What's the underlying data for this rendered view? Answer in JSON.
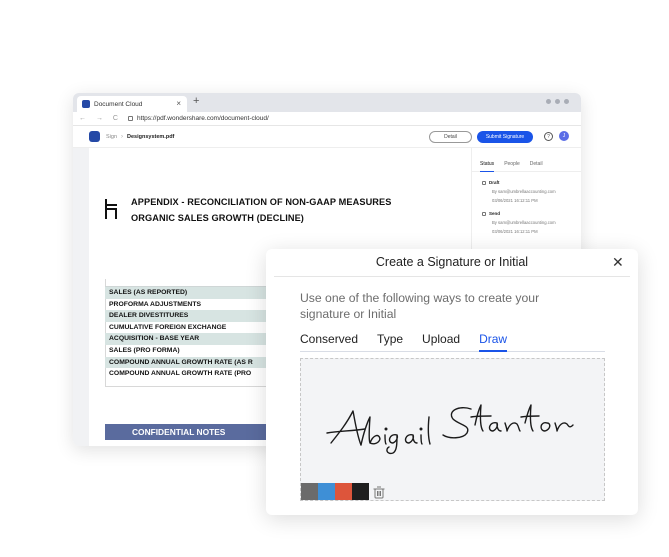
{
  "browser": {
    "tab_title": "Document Cloud",
    "tab_close": "×",
    "new_tab": "+",
    "url": "https://pdf.wondershare.com/document-cloud/",
    "nav": "← → C"
  },
  "app": {
    "breadcrumb_root": "Sign",
    "breadcrumb_sep": "›",
    "filename": "Designsystem.pdf",
    "detail_button": "Detail",
    "submit_button": "Submit Signature",
    "help_icon": "?",
    "avatar_initial": "J"
  },
  "document": {
    "title_line1": "APPENDIX - RECONCILIATION OF NON-GAAP MEASURES",
    "title_line2": "ORGANIC SALES GROWTH (DECLINE)",
    "rows": [
      "SALES (AS REPORTED)",
      "PROFORMA ADJUSTMENTS",
      "DEALER DIVESTITURES",
      "CUMULATIVE FOREIGN EXCHANGE",
      "ACQUISITION - BASE YEAR",
      "SALES (PRO FORMA)",
      "COMPOUND ANNUAL GROWTH RATE (AS R",
      "COMPOUND ANNUAL GROWTH RATE (PRO"
    ],
    "notes_heading": "CONFIDENTIAL NOTES"
  },
  "side_panel": {
    "tabs": [
      "Status",
      "People",
      "Detail"
    ],
    "events": [
      {
        "title": "Draft",
        "by": "By sam@umbrellaaccounting.com",
        "time": "03/06/2021 16:12:11 PM"
      },
      {
        "title": "Send",
        "by": "By sam@umbrellaaccounting.com",
        "time": "03/06/2021 16:12:11 PM"
      }
    ]
  },
  "modal": {
    "title": "Create a Signature or Initial",
    "close": "✕",
    "instruction": "Use one of the following ways to create your signature or Initial",
    "tabs": [
      "Conserved",
      "Type",
      "Upload",
      "Draw"
    ],
    "active_tab": "Draw",
    "signature_text": "Abigail Stanton",
    "palette": [
      "#6b6b6b",
      "#3e8fd6",
      "#dd553b",
      "#1f1f1f"
    ]
  }
}
